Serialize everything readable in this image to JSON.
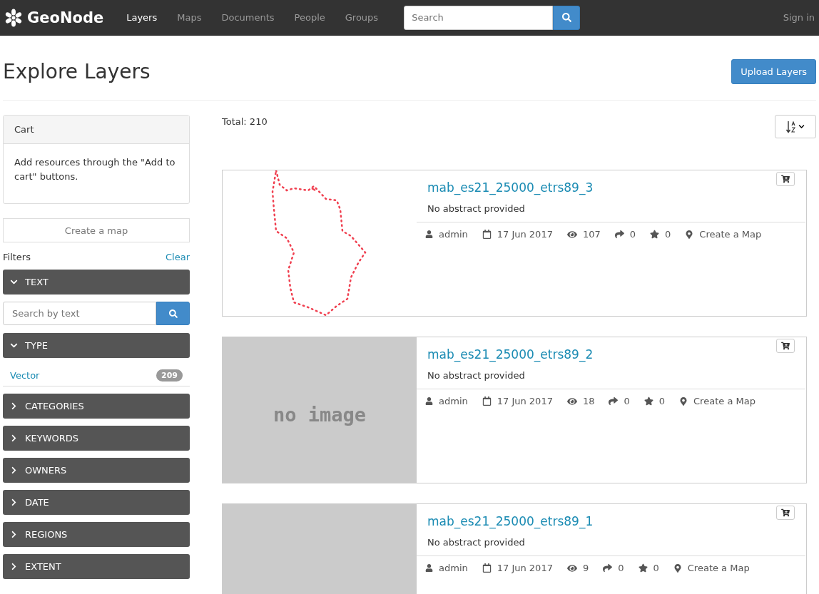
{
  "navbar": {
    "brand": "GeoNode",
    "links": [
      {
        "label": "Layers",
        "selected": true
      },
      {
        "label": "Maps",
        "selected": false
      },
      {
        "label": "Documents",
        "selected": false
      },
      {
        "label": "People",
        "selected": false
      },
      {
        "label": "Groups",
        "selected": false
      }
    ],
    "search": {
      "placeholder": "Search"
    },
    "sign_in": "Sign in"
  },
  "page": {
    "title": "Explore Layers",
    "upload_button": "Upload Layers"
  },
  "sidebar": {
    "cart": {
      "title": "Cart",
      "text": "Add resources through the \"Add to cart\" buttons."
    },
    "create_map": "Create a map",
    "filters_label": "Filters",
    "clear": "Clear",
    "filters": [
      {
        "label": "TEXT",
        "expanded": true,
        "kind": "search",
        "placeholder": "Search by text"
      },
      {
        "label": "TYPE",
        "expanded": true,
        "kind": "list",
        "items": [
          {
            "label": "Vector",
            "count": "209"
          }
        ]
      },
      {
        "label": "CATEGORIES",
        "expanded": false
      },
      {
        "label": "KEYWORDS",
        "expanded": false
      },
      {
        "label": "OWNERS",
        "expanded": false
      },
      {
        "label": "DATE",
        "expanded": false
      },
      {
        "label": "REGIONS",
        "expanded": false
      },
      {
        "label": "EXTENT",
        "expanded": false
      }
    ]
  },
  "results": {
    "total": "Total: 210",
    "layers": [
      {
        "title": "mab_es21_25000_etrs89_3",
        "abstract": "No abstract provided",
        "owner": "admin",
        "date": "17 Jun 2017",
        "views": "107",
        "shares": "0",
        "rating": "0",
        "action": "Create a Map"
      },
      {
        "title": "mab_es21_25000_etrs89_2",
        "abstract": "No abstract provided",
        "thumbnail": {
          "kind": "placeholder",
          "label": "no image"
        },
        "owner": "admin",
        "date": "17 Jun 2017",
        "views": "18",
        "shares": "0",
        "rating": "0",
        "action": "Create a Map"
      },
      {
        "title": "mab_es21_25000_etrs89_1",
        "abstract": "No abstract provided",
        "thumbnail": {
          "kind": "placeholder"
        },
        "owner": "admin",
        "date": "17 Jun 2017",
        "views": "9",
        "shares": "0",
        "rating": "0",
        "action": "Create a Map"
      }
    ]
  }
}
